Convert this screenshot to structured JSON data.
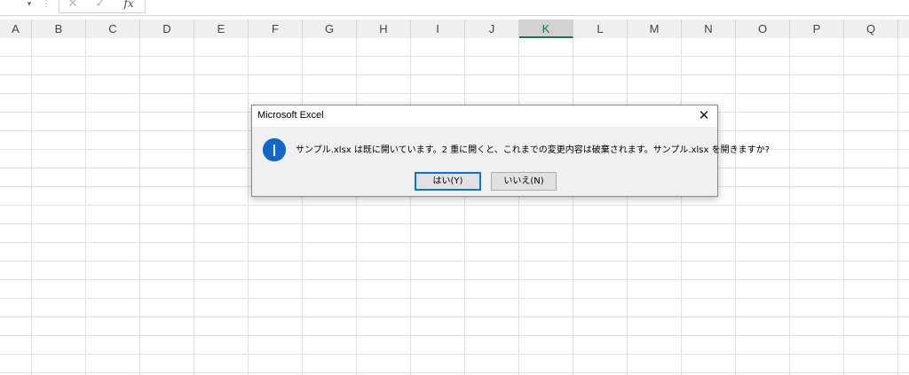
{
  "formula_bar": {
    "namebox_dropdown_glyph": "▾",
    "separator_glyph": "⋮",
    "cancel_glyph": "✕",
    "enter_glyph": "✓",
    "fx_label": "fx"
  },
  "sheet": {
    "columns": [
      "A",
      "B",
      "C",
      "D",
      "E",
      "F",
      "G",
      "H",
      "I",
      "J",
      "K",
      "L",
      "M",
      "N",
      "O",
      "P",
      "Q"
    ],
    "selected_column": "K"
  },
  "dialog": {
    "title": "Microsoft Excel",
    "close_glyph": "✕",
    "icon": "information-icon",
    "message": "サンプル.xlsx は既に開いています。2 重に開くと、これまでの変更内容は破棄されます。サンプル.xlsx を開きますか?",
    "buttons": {
      "yes_label": "はい(Y)",
      "no_label": "いいえ(N)"
    }
  },
  "colors": {
    "accent_green": "#217346",
    "info_blue": "#1467c8",
    "focus_blue": "#0078d7"
  }
}
